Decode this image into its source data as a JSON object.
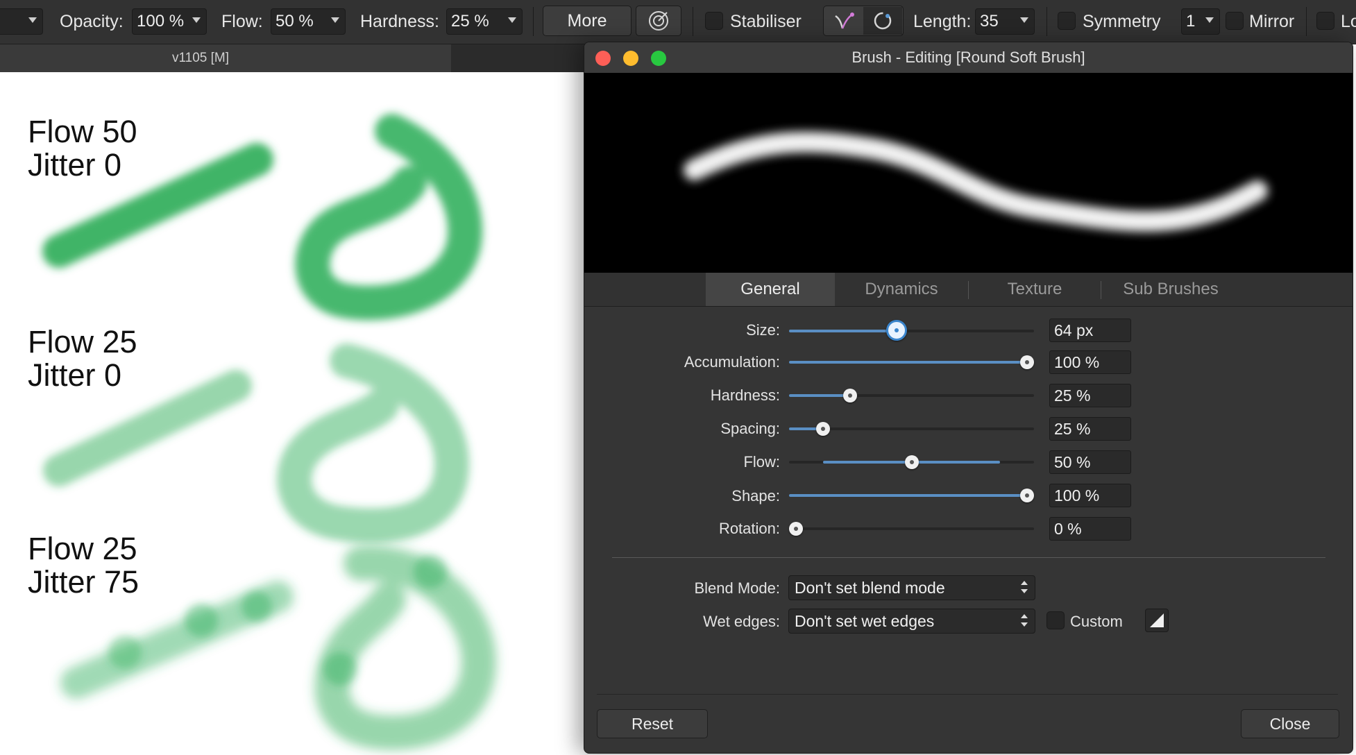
{
  "toolbar": {
    "opacity_label": "Opacity:",
    "opacity_value": "100 %",
    "flow_label": "Flow:",
    "flow_value": "50 %",
    "hardness_label": "Hardness:",
    "hardness_value": "25 %",
    "more_label": "More",
    "stabiliser_label": "Stabiliser",
    "length_label": "Length:",
    "length_value": "35",
    "symmetry_label": "Symmetry",
    "symmetry_value": "1",
    "mirror_label": "Mirror",
    "lock_label": "Lo"
  },
  "document": {
    "tab_label": "v1105  [M]"
  },
  "canvas": {
    "labels": [
      {
        "line1": "Flow 50",
        "line2": "Jitter 0"
      },
      {
        "line1": "Flow 25",
        "line2": "Jitter 0"
      },
      {
        "line1": "Flow 25",
        "line2": "Jitter 75"
      }
    ],
    "stroke_color": "#2fae5a"
  },
  "dialog": {
    "title": "Brush - Editing [Round Soft Brush]",
    "tabs": [
      "General",
      "Dynamics",
      "Texture",
      "Sub Brushes"
    ],
    "active_tab": "General",
    "settings": [
      {
        "label": "Size:",
        "value": "64 px",
        "level": 0.44
      },
      {
        "label": "Accumulation:",
        "value": "100 %",
        "level": 1.0
      },
      {
        "label": "Hardness:",
        "value": "25 %",
        "level": 0.25
      },
      {
        "label": "Spacing:",
        "value": "25 %",
        "level": 0.14
      },
      {
        "label": "Flow:",
        "value": "50 %",
        "level": 0.5
      },
      {
        "label": "Shape:",
        "value": "100 %",
        "level": 1.0
      },
      {
        "label": "Rotation:",
        "value": "0 %",
        "level": 0.0
      }
    ],
    "blend_mode_label": "Blend Mode:",
    "blend_mode_value": "Don't set blend mode",
    "wet_edges_label": "Wet edges:",
    "wet_edges_value": "Don't set wet edges",
    "custom_label": "Custom",
    "reset_label": "Reset",
    "close_label": "Close",
    "accent_color": "#3b85cc"
  }
}
